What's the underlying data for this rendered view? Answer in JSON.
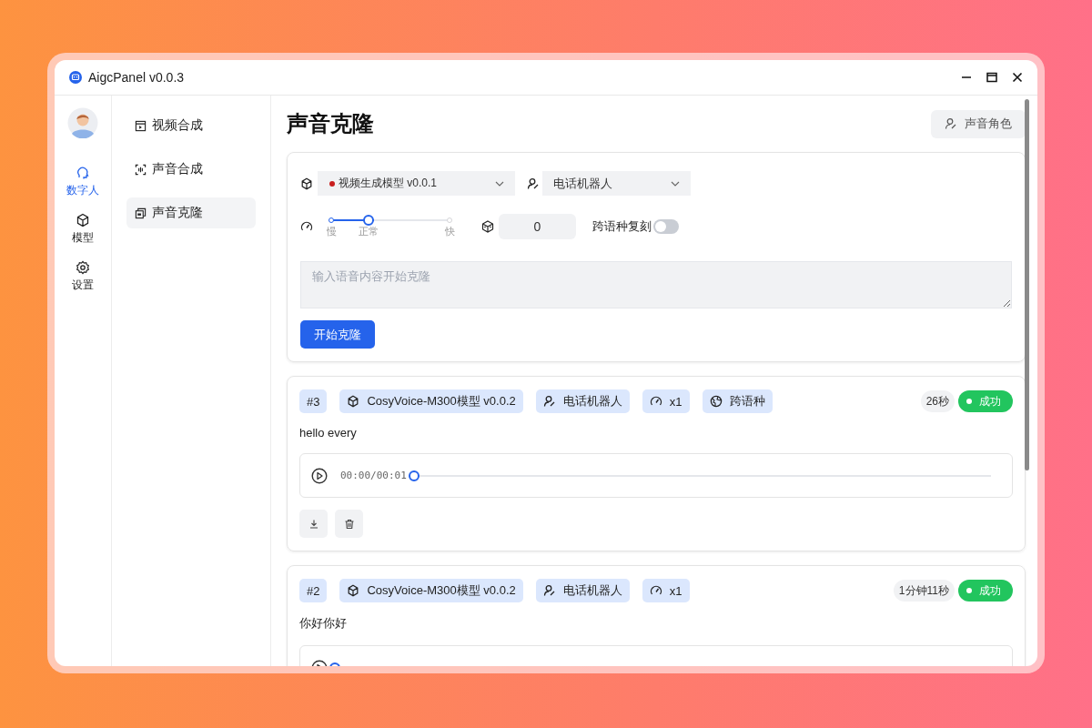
{
  "window": {
    "title": "AigcPanel v0.0.3"
  },
  "rail": [
    {
      "label": "数字人",
      "selected": true
    },
    {
      "label": "模型",
      "selected": false
    },
    {
      "label": "设置",
      "selected": false
    }
  ],
  "submenu": [
    {
      "label": "视频合成",
      "selected": false
    },
    {
      "label": "声音合成",
      "selected": false
    },
    {
      "label": "声音克隆",
      "selected": true
    }
  ],
  "page": {
    "title": "声音克隆",
    "role_button": "声音角色"
  },
  "form": {
    "model_select": {
      "value": "视频生成模型 v0.0.1",
      "running": false
    },
    "speaker_select": {
      "value": "电话机器人"
    },
    "speed": {
      "level": 0.33,
      "labels": [
        "慢",
        "正常",
        "快"
      ]
    },
    "seed": {
      "value": "0"
    },
    "cross_lingual": {
      "label": "跨语种复刻",
      "on": false
    },
    "text": {
      "placeholder": "输入语音内容开始克隆"
    },
    "submit": "开始克隆"
  },
  "records": [
    {
      "id": "#3",
      "tags": [
        {
          "kind": "model",
          "text": "CosyVoice-M300模型 v0.0.2"
        },
        {
          "kind": "speaker",
          "text": "电话机器人"
        },
        {
          "kind": "speed",
          "text": "x1"
        },
        {
          "kind": "cross",
          "text": "跨语种"
        }
      ],
      "duration": "26秒",
      "status": {
        "text": "成功",
        "kind": "success"
      },
      "text": "hello every",
      "player": {
        "time": "00:00/00:01",
        "level": 0
      }
    },
    {
      "id": "#2",
      "tags": [
        {
          "kind": "model",
          "text": "CosyVoice-M300模型 v0.0.2"
        },
        {
          "kind": "speaker",
          "text": "电话机器人"
        },
        {
          "kind": "speed",
          "text": "x1"
        }
      ],
      "duration": "1分钟11秒",
      "status": {
        "text": "成功",
        "kind": "success"
      },
      "text": "你好你好",
      "player": {
        "level": 0
      }
    }
  ]
}
